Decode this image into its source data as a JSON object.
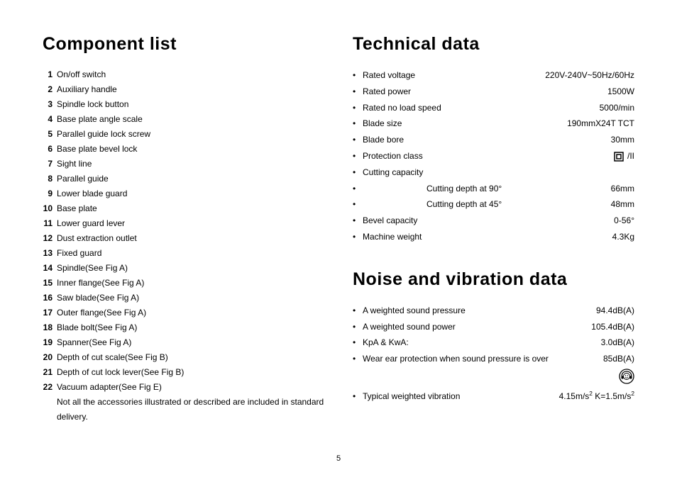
{
  "page_number": "5",
  "left": {
    "title": "Component list",
    "items": [
      {
        "n": "1",
        "t": "On/off switch"
      },
      {
        "n": "2",
        "t": "Auxiliary handle"
      },
      {
        "n": "3",
        "t": "Spindle lock button"
      },
      {
        "n": "4",
        "t": "Base plate angle scale"
      },
      {
        "n": "5",
        "t": "Parallel guide lock screw"
      },
      {
        "n": "6",
        "t": "Base plate bevel lock"
      },
      {
        "n": "7",
        "t": "Sight line"
      },
      {
        "n": "8",
        "t": "Parallel guide"
      },
      {
        "n": "9",
        "t": "Lower blade guard"
      },
      {
        "n": "10",
        "t": "Base plate"
      },
      {
        "n": "11",
        "t": "Lower guard lever"
      },
      {
        "n": "12",
        "t": "Dust extraction outlet"
      },
      {
        "n": "13",
        "t": "Fixed guard"
      },
      {
        "n": "14",
        "t": "Spindle(See Fig A)"
      },
      {
        "n": "15",
        "t": "Inner flange(See Fig A)"
      },
      {
        "n": "16",
        "t": "Saw blade(See Fig A)"
      },
      {
        "n": "17",
        "t": "Outer flange(See Fig A)"
      },
      {
        "n": "18",
        "t": "Blade bolt(See Fig A)"
      },
      {
        "n": "19",
        "t": "Spanner(See Fig A)"
      },
      {
        "n": "20",
        "t": "Depth of cut scale(See Fig B)"
      },
      {
        "n": "21",
        "t": "Depth of cut lock lever(See Fig B)"
      },
      {
        "n": "22",
        "t": "Vacuum adapter(See Fig E)"
      }
    ],
    "note": "Not all the accessories illustrated or described are included in standard delivery."
  },
  "right": {
    "tech_title": "Technical data",
    "tech": [
      {
        "k": "Rated voltage",
        "v": "220V-240V~50Hz/60Hz"
      },
      {
        "k": "Rated power",
        "v": "1500W"
      },
      {
        "k": "Rated no load speed",
        "v": "5000/min"
      },
      {
        "k": "Blade size",
        "v": "190mmX24T TCT"
      },
      {
        "k": "Blade bore",
        "v": "30mm"
      },
      {
        "k": "Protection class",
        "v": "/II",
        "icon": true
      },
      {
        "k": "Cutting capacity",
        "v": ""
      },
      {
        "k": "Cutting depth at 90°",
        "v": "66mm",
        "indent": true
      },
      {
        "k": "Cutting depth at 45°",
        "v": "48mm",
        "indent": true
      },
      {
        "k": "Bevel capacity",
        "v": "0-56°"
      },
      {
        "k": "Machine weight",
        "v": "4.3Kg"
      }
    ],
    "noise_title": "Noise and vibration data",
    "noise": [
      {
        "k": "A weighted sound pressure",
        "v": "94.4dB(A)"
      },
      {
        "k": "A weighted sound power",
        "v": "105.4dB(A)"
      },
      {
        "k": "KpA & KwA:",
        "v": "3.0dB(A)"
      },
      {
        "k": "Wear ear protection when sound pressure is over",
        "v": "85dB(A)"
      }
    ],
    "vibration": {
      "k": "Typical weighted vibration",
      "v": "4.15m/s²   K=1.5m/s²"
    }
  }
}
